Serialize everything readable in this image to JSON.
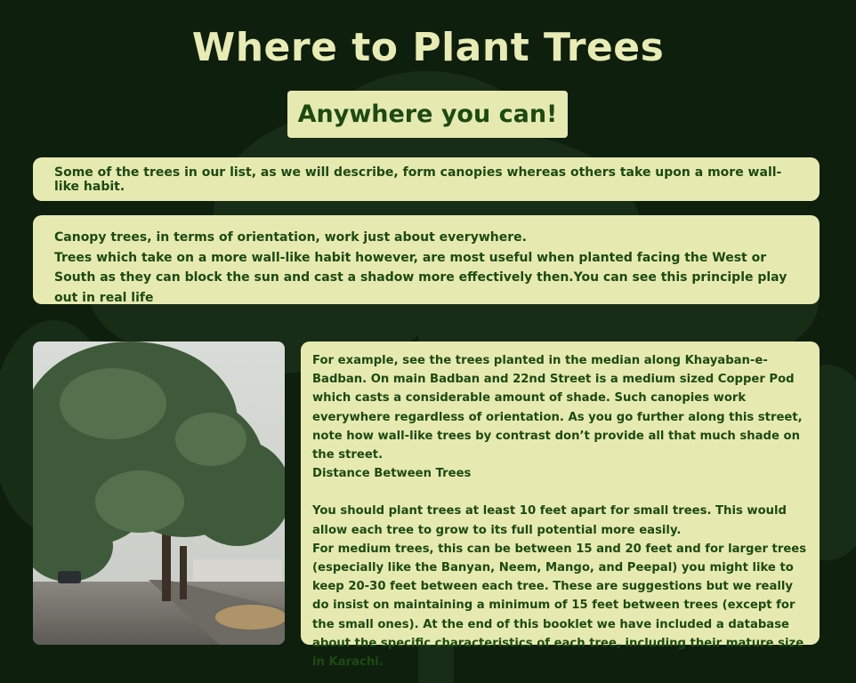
{
  "title": "Where to Plant Trees",
  "subtitle": "Anywhere you can!",
  "intro": "Some of the trees in our list, as we will describe, form canopies whereas others take upon a more wall-like habit.",
  "orientation": {
    "line1": "Canopy trees, in terms of orientation, work just about everywhere.",
    "line2": "Trees which take on a more wall-like habit however, are most useful when planted facing the West or South as they can block the sun and cast a shadow more effectively then.You can see this principle play out in real life"
  },
  "example": {
    "para1": "For example, see the trees planted in the median along Khayaban-e-Badban. On main Badban and 22nd Street is a medium sized Copper Pod which casts a considerable amount of shade. Such canopies work everywhere regardless of orientation. As you go further along this street, note how wall-like trees by contrast don’t provide all that much shade on the street.",
    "heading": "Distance Between Trees",
    "para2": "You should plant trees at least 10 feet apart for small trees. This would allow each tree to grow to its full potential more easily.",
    "para3": "For medium trees, this can be between 15 and 20 feet and for larger trees (especially like the Banyan, Neem, Mango, and Peepal) you might like to keep 20-30 feet between each tree. These are suggestions but we really do insist on maintaining a minimum of 15 feet between trees (except for the small ones). At the end of this booklet we have included a database about the specific characteristics of each tree, including their mature size in Karachi."
  },
  "colors": {
    "background": "#0e1f0e",
    "panel": "#e7eab0",
    "text": "#1c4a12",
    "title": "#e8ebb4"
  }
}
